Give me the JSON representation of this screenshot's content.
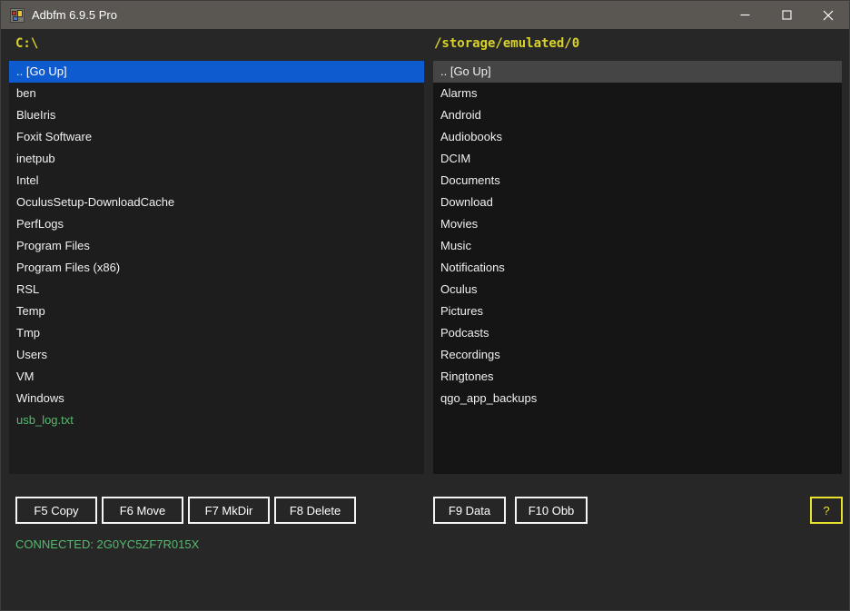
{
  "window": {
    "title": "Adbfm 6.9.5 Pro"
  },
  "left_panel": {
    "path": "C:\\",
    "focused": true,
    "items": [
      {
        "label": ".. [Go Up]",
        "type": "up",
        "selected": true
      },
      {
        "label": "ben",
        "type": "dir"
      },
      {
        "label": "BlueIris",
        "type": "dir"
      },
      {
        "label": "Foxit Software",
        "type": "dir"
      },
      {
        "label": "inetpub",
        "type": "dir"
      },
      {
        "label": "Intel",
        "type": "dir"
      },
      {
        "label": "OculusSetup-DownloadCache",
        "type": "dir"
      },
      {
        "label": "PerfLogs",
        "type": "dir"
      },
      {
        "label": "Program Files",
        "type": "dir"
      },
      {
        "label": "Program Files (x86)",
        "type": "dir"
      },
      {
        "label": "RSL",
        "type": "dir"
      },
      {
        "label": "Temp",
        "type": "dir"
      },
      {
        "label": "Tmp",
        "type": "dir"
      },
      {
        "label": "Users",
        "type": "dir"
      },
      {
        "label": "VM",
        "type": "dir"
      },
      {
        "label": "Windows",
        "type": "dir"
      },
      {
        "label": "usb_log.txt",
        "type": "file"
      }
    ]
  },
  "right_panel": {
    "path": "/storage/emulated/0",
    "focused": false,
    "items": [
      {
        "label": ".. [Go Up]",
        "type": "up",
        "selected": true
      },
      {
        "label": "Alarms",
        "type": "dir"
      },
      {
        "label": "Android",
        "type": "dir"
      },
      {
        "label": "Audiobooks",
        "type": "dir"
      },
      {
        "label": "DCIM",
        "type": "dir"
      },
      {
        "label": "Documents",
        "type": "dir"
      },
      {
        "label": "Download",
        "type": "dir"
      },
      {
        "label": "Movies",
        "type": "dir"
      },
      {
        "label": "Music",
        "type": "dir"
      },
      {
        "label": "Notifications",
        "type": "dir"
      },
      {
        "label": "Oculus",
        "type": "dir"
      },
      {
        "label": "Pictures",
        "type": "dir"
      },
      {
        "label": "Podcasts",
        "type": "dir"
      },
      {
        "label": "Recordings",
        "type": "dir"
      },
      {
        "label": "Ringtones",
        "type": "dir"
      },
      {
        "label": "qgo_app_backups",
        "type": "dir"
      }
    ]
  },
  "toolbar": {
    "left_buttons": [
      "F5 Copy",
      "F6 Move",
      "F7 MkDir",
      "F8 Delete"
    ],
    "right_buttons": [
      "F9 Data",
      "F10 Obb"
    ],
    "help_button": "?"
  },
  "status": {
    "text": "CONNECTED: 2G0YC5ZF7R015X"
  },
  "icons": {
    "app_icon": "winforms-app-icon",
    "minimize": "minimize-icon",
    "maximize": "maximize-icon",
    "close": "close-icon"
  },
  "colors": {
    "titlebar": "#5a5652",
    "window_bg": "#272727",
    "list_bg_left": "#1d1d1d",
    "list_bg_right": "#151515",
    "path_yellow": "#d8d22b",
    "selection_active_blue": "#0d5bce",
    "selection_inactive_gray": "#454545",
    "file_green": "#55bb6e",
    "status_green": "#55bb6e",
    "help_yellow": "#e8e22c",
    "text": "#f0f0f0"
  }
}
